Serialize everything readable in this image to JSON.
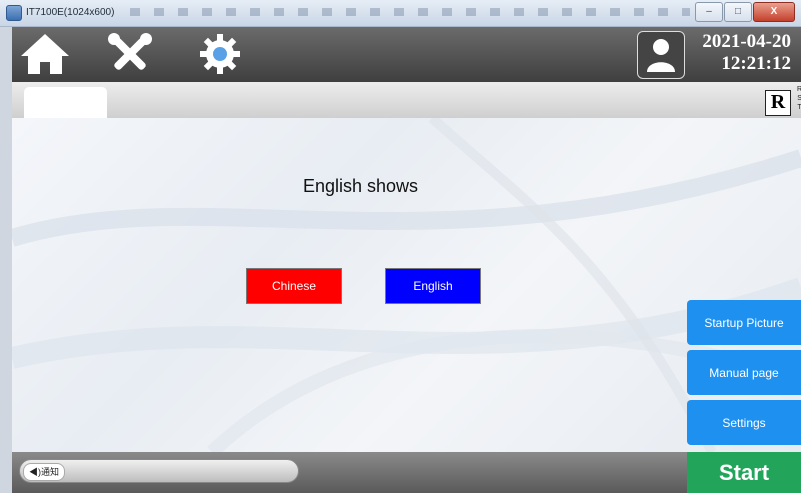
{
  "window": {
    "title": "IT7100E(1024x600)",
    "minimize_label": "–",
    "maximize_label": "□",
    "close_label": "X"
  },
  "header": {
    "icons": [
      "home-icon",
      "tools-icon",
      "gear-icon",
      "user-icon"
    ],
    "date": "2021-04-20",
    "time": "12:21:12",
    "background_color": "#4a4a4a"
  },
  "tabstrip": {
    "record_label": "R",
    "rst_labels": [
      "R",
      "S",
      "T"
    ]
  },
  "main": {
    "headline": "English shows",
    "language_buttons": [
      {
        "label": "Chinese",
        "color": "#ff0000"
      },
      {
        "label": "English",
        "color": "#0000ff"
      }
    ],
    "side_buttons": [
      {
        "label": "Startup Picture",
        "color": "#1e90f0"
      },
      {
        "label": "Manual page",
        "color": "#1e90f0"
      },
      {
        "label": "Settings",
        "color": "#1e90f0"
      }
    ]
  },
  "bottombar": {
    "notice_label": "◀)通知",
    "start_label": "Start",
    "start_color": "#22a55a"
  }
}
